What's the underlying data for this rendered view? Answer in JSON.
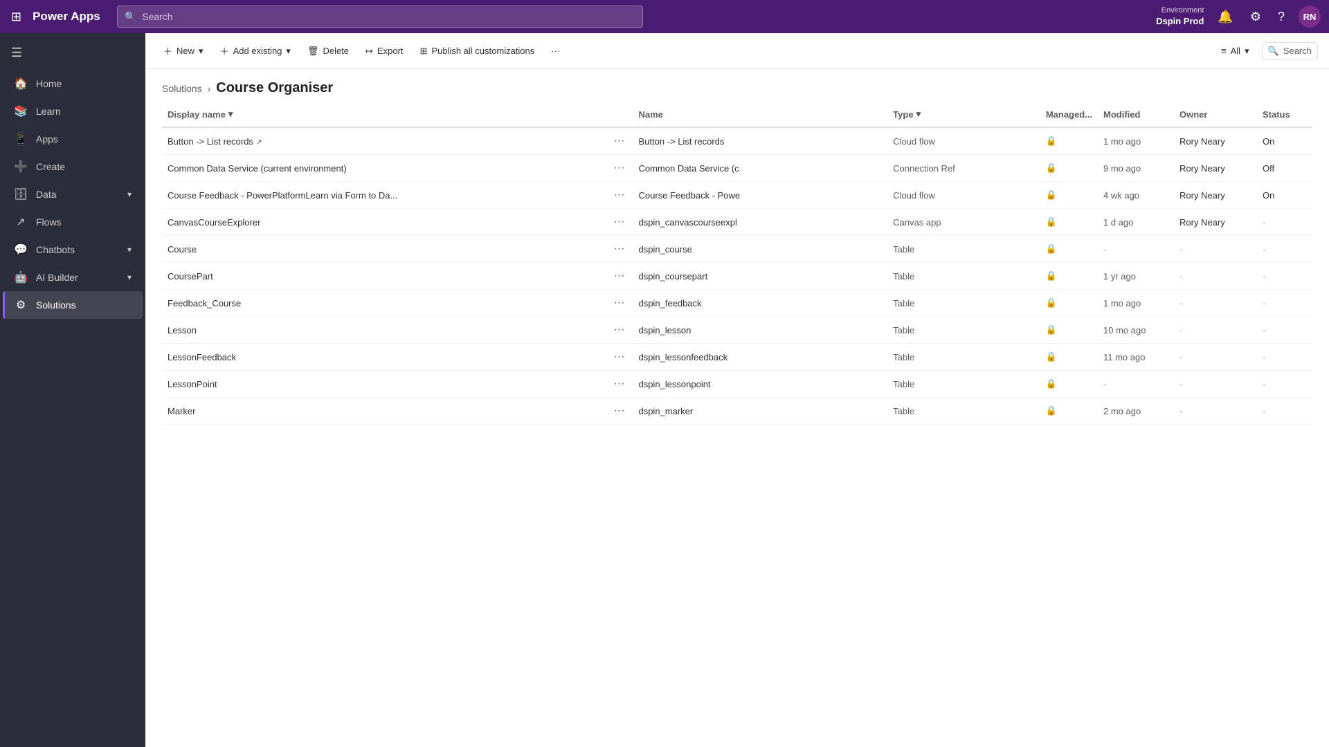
{
  "topNav": {
    "appTitle": "Power Apps",
    "searchPlaceholder": "Search",
    "environment": {
      "label": "Environment",
      "name": "Dspin Prod"
    },
    "avatarInitials": "RN"
  },
  "sidebar": {
    "toggleTitle": "Collapse",
    "items": [
      {
        "id": "home",
        "label": "Home",
        "icon": "🏠",
        "active": false
      },
      {
        "id": "learn",
        "label": "Learn",
        "icon": "📚",
        "active": false
      },
      {
        "id": "apps",
        "label": "Apps",
        "icon": "📱",
        "active": false
      },
      {
        "id": "create",
        "label": "Create",
        "icon": "➕",
        "active": false
      },
      {
        "id": "data",
        "label": "Data",
        "icon": "🗄",
        "active": false,
        "hasChevron": true
      },
      {
        "id": "flows",
        "label": "Flows",
        "icon": "↗",
        "active": false
      },
      {
        "id": "chatbots",
        "label": "Chatbots",
        "icon": "💬",
        "active": false,
        "hasChevron": true
      },
      {
        "id": "ai-builder",
        "label": "AI Builder",
        "icon": "🤖",
        "active": false,
        "hasChevron": true
      },
      {
        "id": "solutions",
        "label": "Solutions",
        "icon": "⚙",
        "active": true
      }
    ]
  },
  "toolbar": {
    "newLabel": "New",
    "addExistingLabel": "Add existing",
    "deleteLabel": "Delete",
    "exportLabel": "Export",
    "publishLabel": "Publish all customizations",
    "moreLabel": "···",
    "filterLabel": "All",
    "searchLabel": "Search"
  },
  "breadcrumb": {
    "parentLabel": "Solutions",
    "currentLabel": "Course Organiser"
  },
  "table": {
    "columns": [
      {
        "id": "displayName",
        "label": "Display name"
      },
      {
        "id": "options",
        "label": ""
      },
      {
        "id": "name",
        "label": "Name"
      },
      {
        "id": "type",
        "label": "Type"
      },
      {
        "id": "managed",
        "label": "Managed..."
      },
      {
        "id": "modified",
        "label": "Modified"
      },
      {
        "id": "owner",
        "label": "Owner"
      },
      {
        "id": "status",
        "label": "Status"
      }
    ],
    "rows": [
      {
        "displayName": "Button -> List records",
        "hasExternalLink": true,
        "name": "Button -> List records",
        "type": "Cloud flow",
        "hasLock": true,
        "modified": "1 mo ago",
        "owner": "Rory Neary",
        "status": "On"
      },
      {
        "displayName": "Common Data Service (current environment)",
        "hasExternalLink": false,
        "name": "Common Data Service (c",
        "type": "Connection Ref",
        "hasLock": true,
        "modified": "9 mo ago",
        "owner": "Rory Neary",
        "status": "Off"
      },
      {
        "displayName": "Course Feedback - PowerPlatformLearn via Form to Da...",
        "hasExternalLink": false,
        "name": "Course Feedback - Powe",
        "type": "Cloud flow",
        "hasLock": true,
        "modified": "4 wk ago",
        "owner": "Rory Neary",
        "status": "On"
      },
      {
        "displayName": "CanvasCourseExplorer",
        "hasExternalLink": false,
        "name": "dspin_canvascourseexpl",
        "type": "Canvas app",
        "hasLock": true,
        "modified": "1 d ago",
        "owner": "Rory Neary",
        "status": "-"
      },
      {
        "displayName": "Course",
        "hasExternalLink": false,
        "name": "dspin_course",
        "type": "Table",
        "hasLock": true,
        "modified": "-",
        "owner": "-",
        "status": "-"
      },
      {
        "displayName": "CoursePart",
        "hasExternalLink": false,
        "name": "dspin_coursepart",
        "type": "Table",
        "hasLock": true,
        "modified": "1 yr ago",
        "owner": "-",
        "status": "-"
      },
      {
        "displayName": "Feedback_Course",
        "hasExternalLink": false,
        "name": "dspin_feedback",
        "type": "Table",
        "hasLock": true,
        "modified": "1 mo ago",
        "owner": "-",
        "status": "-"
      },
      {
        "displayName": "Lesson",
        "hasExternalLink": false,
        "name": "dspin_lesson",
        "type": "Table",
        "hasLock": true,
        "modified": "10 mo ago",
        "owner": "-",
        "status": "-"
      },
      {
        "displayName": "LessonFeedback",
        "hasExternalLink": false,
        "name": "dspin_lessonfeedback",
        "type": "Table",
        "hasLock": true,
        "modified": "11 mo ago",
        "owner": "-",
        "status": "-"
      },
      {
        "displayName": "LessonPoint",
        "hasExternalLink": false,
        "name": "dspin_lessonpoint",
        "type": "Table",
        "hasLock": true,
        "modified": "-",
        "owner": "-",
        "status": "-"
      },
      {
        "displayName": "Marker",
        "hasExternalLink": false,
        "name": "dspin_marker",
        "type": "Table",
        "hasLock": true,
        "modified": "2 mo ago",
        "owner": "-",
        "status": "-"
      }
    ]
  }
}
